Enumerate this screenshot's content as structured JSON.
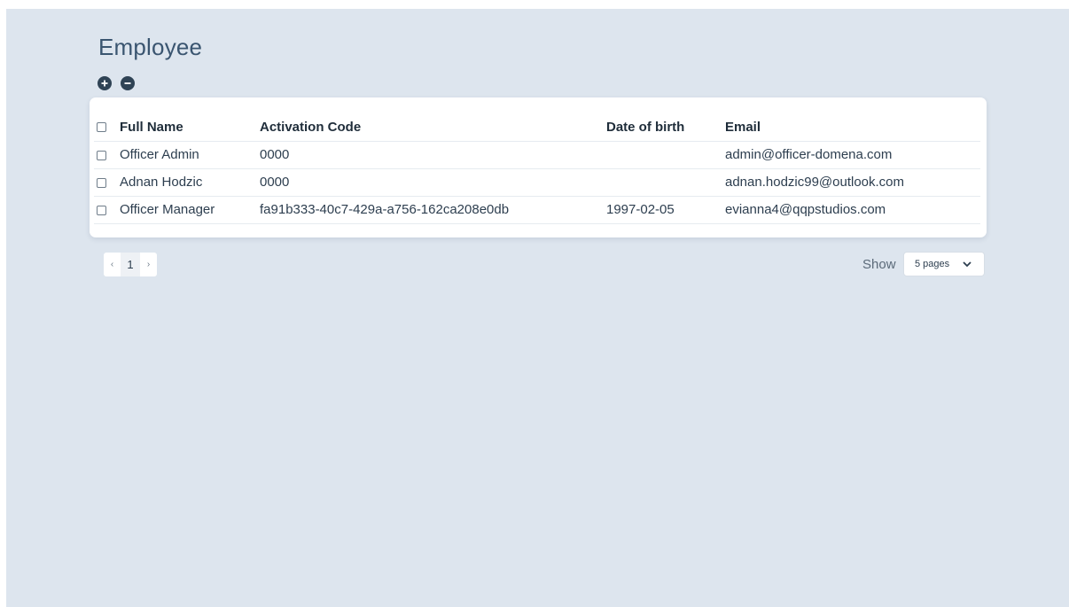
{
  "page": {
    "title": "Employee"
  },
  "toolbar": {
    "add_icon": "plus-circle-icon",
    "remove_icon": "minus-circle-icon"
  },
  "table": {
    "columns": [
      "Full Name",
      "Activation Code",
      "Date of birth",
      "Email"
    ],
    "rows": [
      {
        "full_name": "Officer Admin",
        "activation_code": "0000",
        "dob": "",
        "email": "admin@officer-domena.com"
      },
      {
        "full_name": "Adnan Hodzic",
        "activation_code": "0000",
        "dob": "",
        "email": "adnan.hodzic99@outlook.com"
      },
      {
        "full_name": "Officer Manager",
        "activation_code": "fa91b333-40c7-429a-a756-162ca208e0db",
        "dob": "1997-02-05",
        "email": "evianna4@qqpstudios.com"
      }
    ]
  },
  "pagination": {
    "prev": "‹",
    "current_page": "1",
    "next": "›"
  },
  "page_size": {
    "label": "Show",
    "selected": "5 pages"
  },
  "colors": {
    "background": "#dde5ee",
    "title": "#3a5570",
    "icon_button": "#2f4355"
  }
}
